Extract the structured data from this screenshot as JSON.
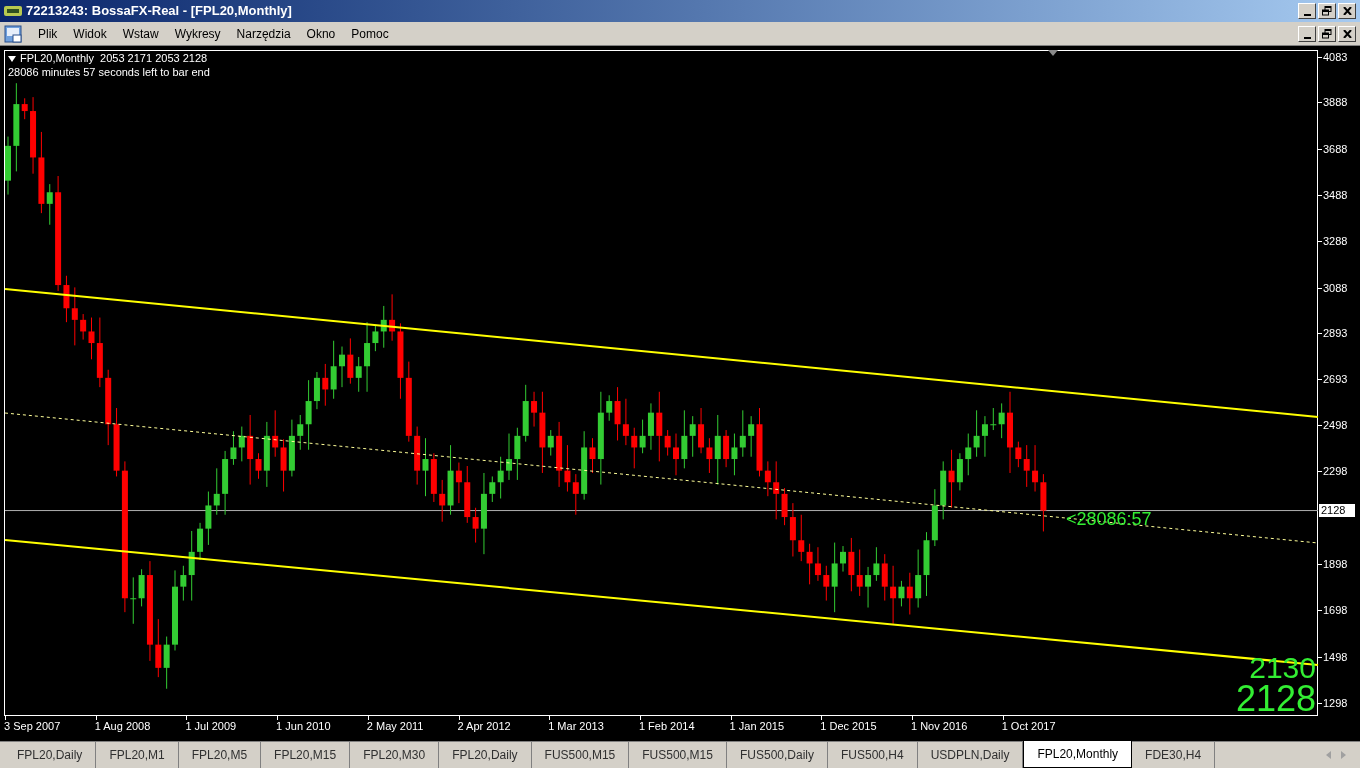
{
  "window": {
    "title": "72213243: BossaFX-Real - [FPL20,Monthly]"
  },
  "menu": [
    "Plik",
    "Widok",
    "Wstaw",
    "Wykresy",
    "Narzędzia",
    "Okno",
    "Pomoc"
  ],
  "chart": {
    "header": "FPL20,Monthly  2053 2171 2053 2128",
    "countdown": "28086 minutes 57 seconds left to bar end",
    "price_tag": "2128",
    "timer_label": "<28086:57",
    "big_numbers": [
      "2130",
      "2128"
    ],
    "y_axis": [
      "4083",
      "3888",
      "3688",
      "3488",
      "3288",
      "3088",
      "2893",
      "2693",
      "2498",
      "2298",
      "1898",
      "1698",
      "1498",
      "1298"
    ],
    "x_axis": [
      "3 Sep 2007",
      "1 Aug 2008",
      "1 Jul 2009",
      "1 Jun 2010",
      "2 May 2011",
      "2 Apr 2012",
      "1 Mar 2013",
      "1 Feb 2014",
      "1 Jan 2015",
      "1 Dec 2015",
      "1 Nov 2016",
      "1 Oct 2017"
    ]
  },
  "tabs": [
    {
      "label": "FPL20,Daily",
      "selected": false
    },
    {
      "label": "FPL20,M1",
      "selected": false
    },
    {
      "label": "FPL20,M5",
      "selected": false
    },
    {
      "label": "FPL20,M15",
      "selected": false
    },
    {
      "label": "FPL20,M30",
      "selected": false
    },
    {
      "label": "FPL20,Daily",
      "selected": false
    },
    {
      "label": "FUS500,M15",
      "selected": false
    },
    {
      "label": "FUS500,M15",
      "selected": false
    },
    {
      "label": "FUS500,Daily",
      "selected": false
    },
    {
      "label": "FUS500,H4",
      "selected": false
    },
    {
      "label": "USDPLN,Daily",
      "selected": false
    },
    {
      "label": "FPL20,Monthly",
      "selected": true
    },
    {
      "label": "FDE30,H4",
      "selected": false
    }
  ]
}
